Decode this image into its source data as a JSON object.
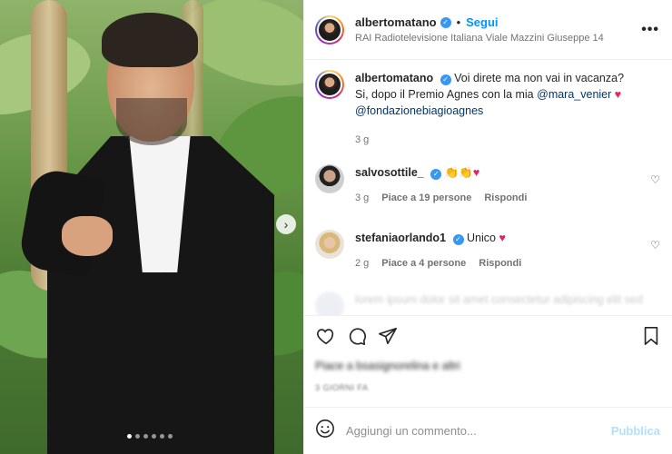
{
  "header": {
    "username": "albertomatano",
    "separator": "•",
    "follow_label": "Segui",
    "location": "RAI Radiotelevisione Italiana Viale Mazzini Giuseppe 14",
    "more_label": "•••"
  },
  "caption": {
    "username": "albertomatano",
    "text_1": "Voi direte ma non vai in vacanza?",
    "text_2": "Si, dopo il Premio Agnes con la mia",
    "mention_1": "@mara_venier",
    "mention_2": "@fondazionebiagioagnes",
    "time": "3 g"
  },
  "comments": [
    {
      "username": "salvosottile_",
      "text": "👏👏",
      "time": "3 g",
      "likes": "Piace a 19 persone",
      "reply": "Rispondi"
    },
    {
      "username": "stefaniaorlando1",
      "text": "Unico",
      "time": "2 g",
      "likes": "Piace a 4 persone",
      "reply": "Rispondi"
    }
  ],
  "blurred_comment": "lorem ipsum dolor sit amet consectetur adipiscing elit sed",
  "footer": {
    "likes_text": "Piace a bsasignorelina e altri",
    "date_text": "3 GIORNI FA",
    "comment_placeholder": "Aggiungi un commento...",
    "publish_label": "Pubblica"
  },
  "carousel": {
    "dot_count": 6,
    "active_index": 0
  },
  "colors": {
    "accent": "#0095f6",
    "verified": "#3897f0",
    "heart": "#e0245e"
  }
}
